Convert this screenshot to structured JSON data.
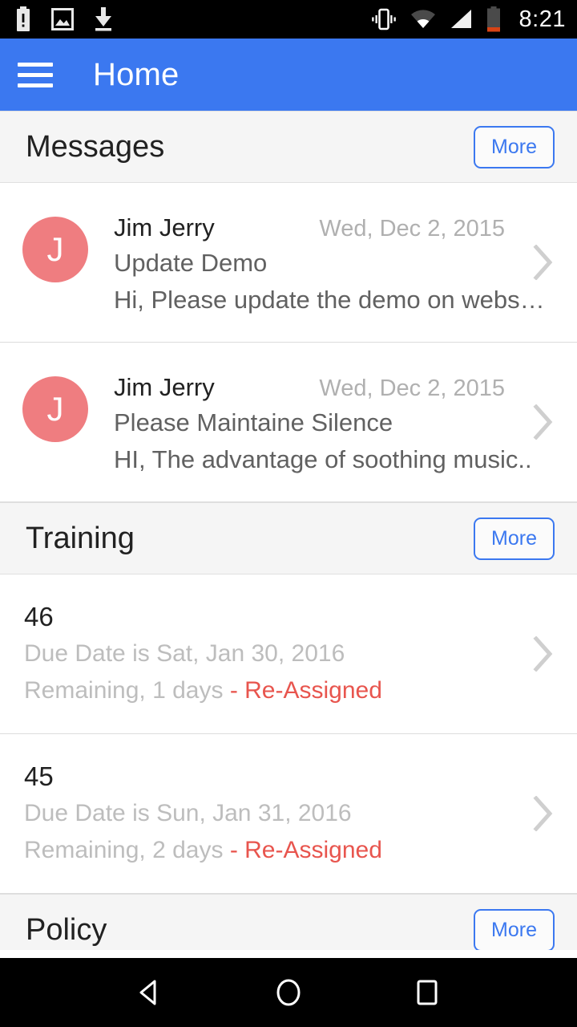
{
  "status_bar": {
    "time": "8:21",
    "icons_left": [
      "battery-alert-icon",
      "screenshot-image-icon",
      "download-icon"
    ],
    "icons_right": [
      "vibrate-icon",
      "wifi-icon",
      "cell-signal-icon",
      "battery-icon"
    ]
  },
  "app_bar": {
    "title": "Home",
    "menu_icon": "hamburger-menu-icon",
    "background_color": "#3B78F0"
  },
  "sections": [
    {
      "id": "messages",
      "title": "Messages",
      "more_label": "More"
    },
    {
      "id": "training",
      "title": "Training",
      "more_label": "More"
    },
    {
      "id": "policy",
      "title": "Policy",
      "more_label": "More"
    }
  ],
  "messages": [
    {
      "avatar_initial": "J",
      "avatar_color": "#EF7D80",
      "sender": "Jim Jerry",
      "date": "Wed, Dec 2, 2015",
      "subject": "Update Demo",
      "preview": "Hi, Please update the demo on webs…"
    },
    {
      "avatar_initial": "J",
      "avatar_color": "#EF7D80",
      "sender": "Jim Jerry",
      "date": "Wed, Dec 2, 2015",
      "subject": "Please Maintaine Silence",
      "preview": "HI, The advantage of soothing music.."
    }
  ],
  "trainings": [
    {
      "title": "46",
      "due": "Due Date is Sat, Jan 30, 2016",
      "remaining": "Remaining, 1 days ",
      "status": "- Re-Assigned",
      "status_color": "#E8554E"
    },
    {
      "title": "45",
      "due": "Due Date is Sun, Jan 31, 2016",
      "remaining": "Remaining, 2 days ",
      "status": "- Re-Assigned",
      "status_color": "#E8554E"
    }
  ],
  "nav_bar": {
    "back_label": "back-icon",
    "home_label": "home-icon",
    "recents_label": "recents-icon"
  }
}
